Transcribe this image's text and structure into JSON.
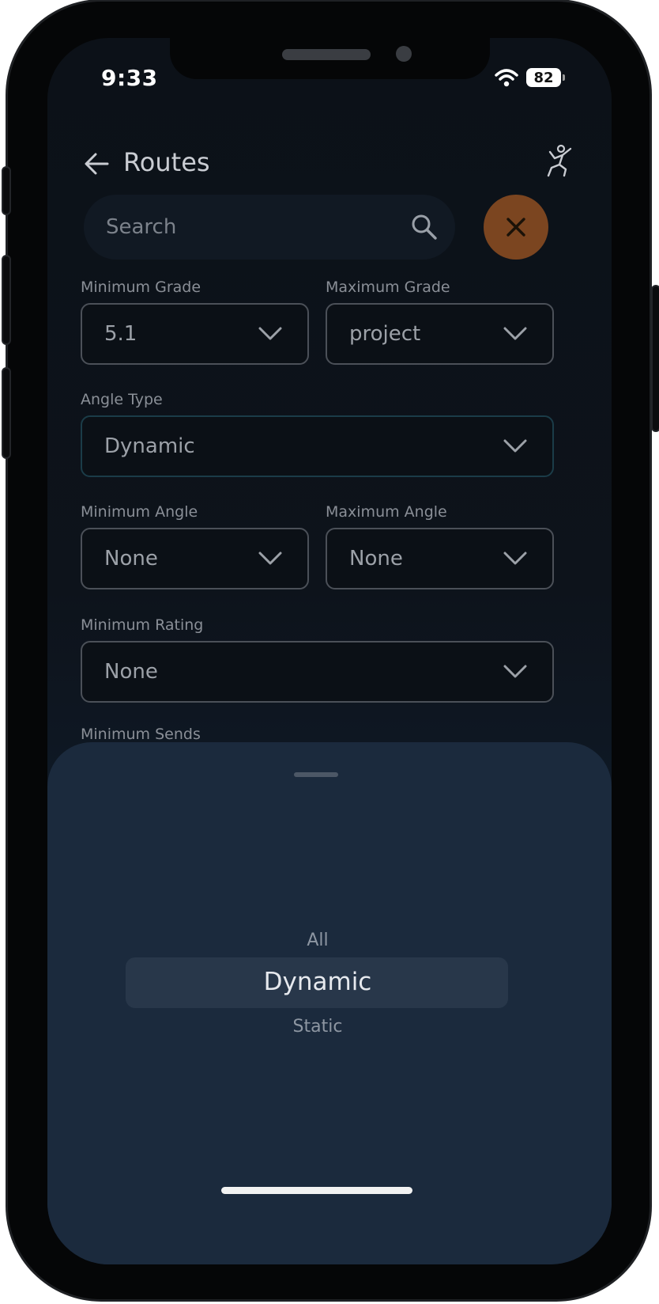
{
  "status_bar": {
    "time": "9:33",
    "battery": "82"
  },
  "header": {
    "title": "Routes"
  },
  "search": {
    "placeholder": "Search"
  },
  "filters": {
    "min_grade": {
      "label": "Minimum Grade",
      "value": "5.1"
    },
    "max_grade": {
      "label": "Maximum Grade",
      "value": "project"
    },
    "angle_type": {
      "label": "Angle Type",
      "value": "Dynamic"
    },
    "min_angle": {
      "label": "Minimum Angle",
      "value": "None"
    },
    "max_angle": {
      "label": "Maximum Angle",
      "value": "None"
    },
    "min_rating": {
      "label": "Minimum Rating",
      "value": "None"
    },
    "min_sends": {
      "label": "Minimum Sends"
    }
  },
  "picker": {
    "options": [
      "All",
      "Dynamic",
      "Static"
    ],
    "selected": "Dynamic"
  },
  "colors": {
    "accent": "#7b4520",
    "background": "#0c1118",
    "sheet": "#1b2a3d"
  }
}
